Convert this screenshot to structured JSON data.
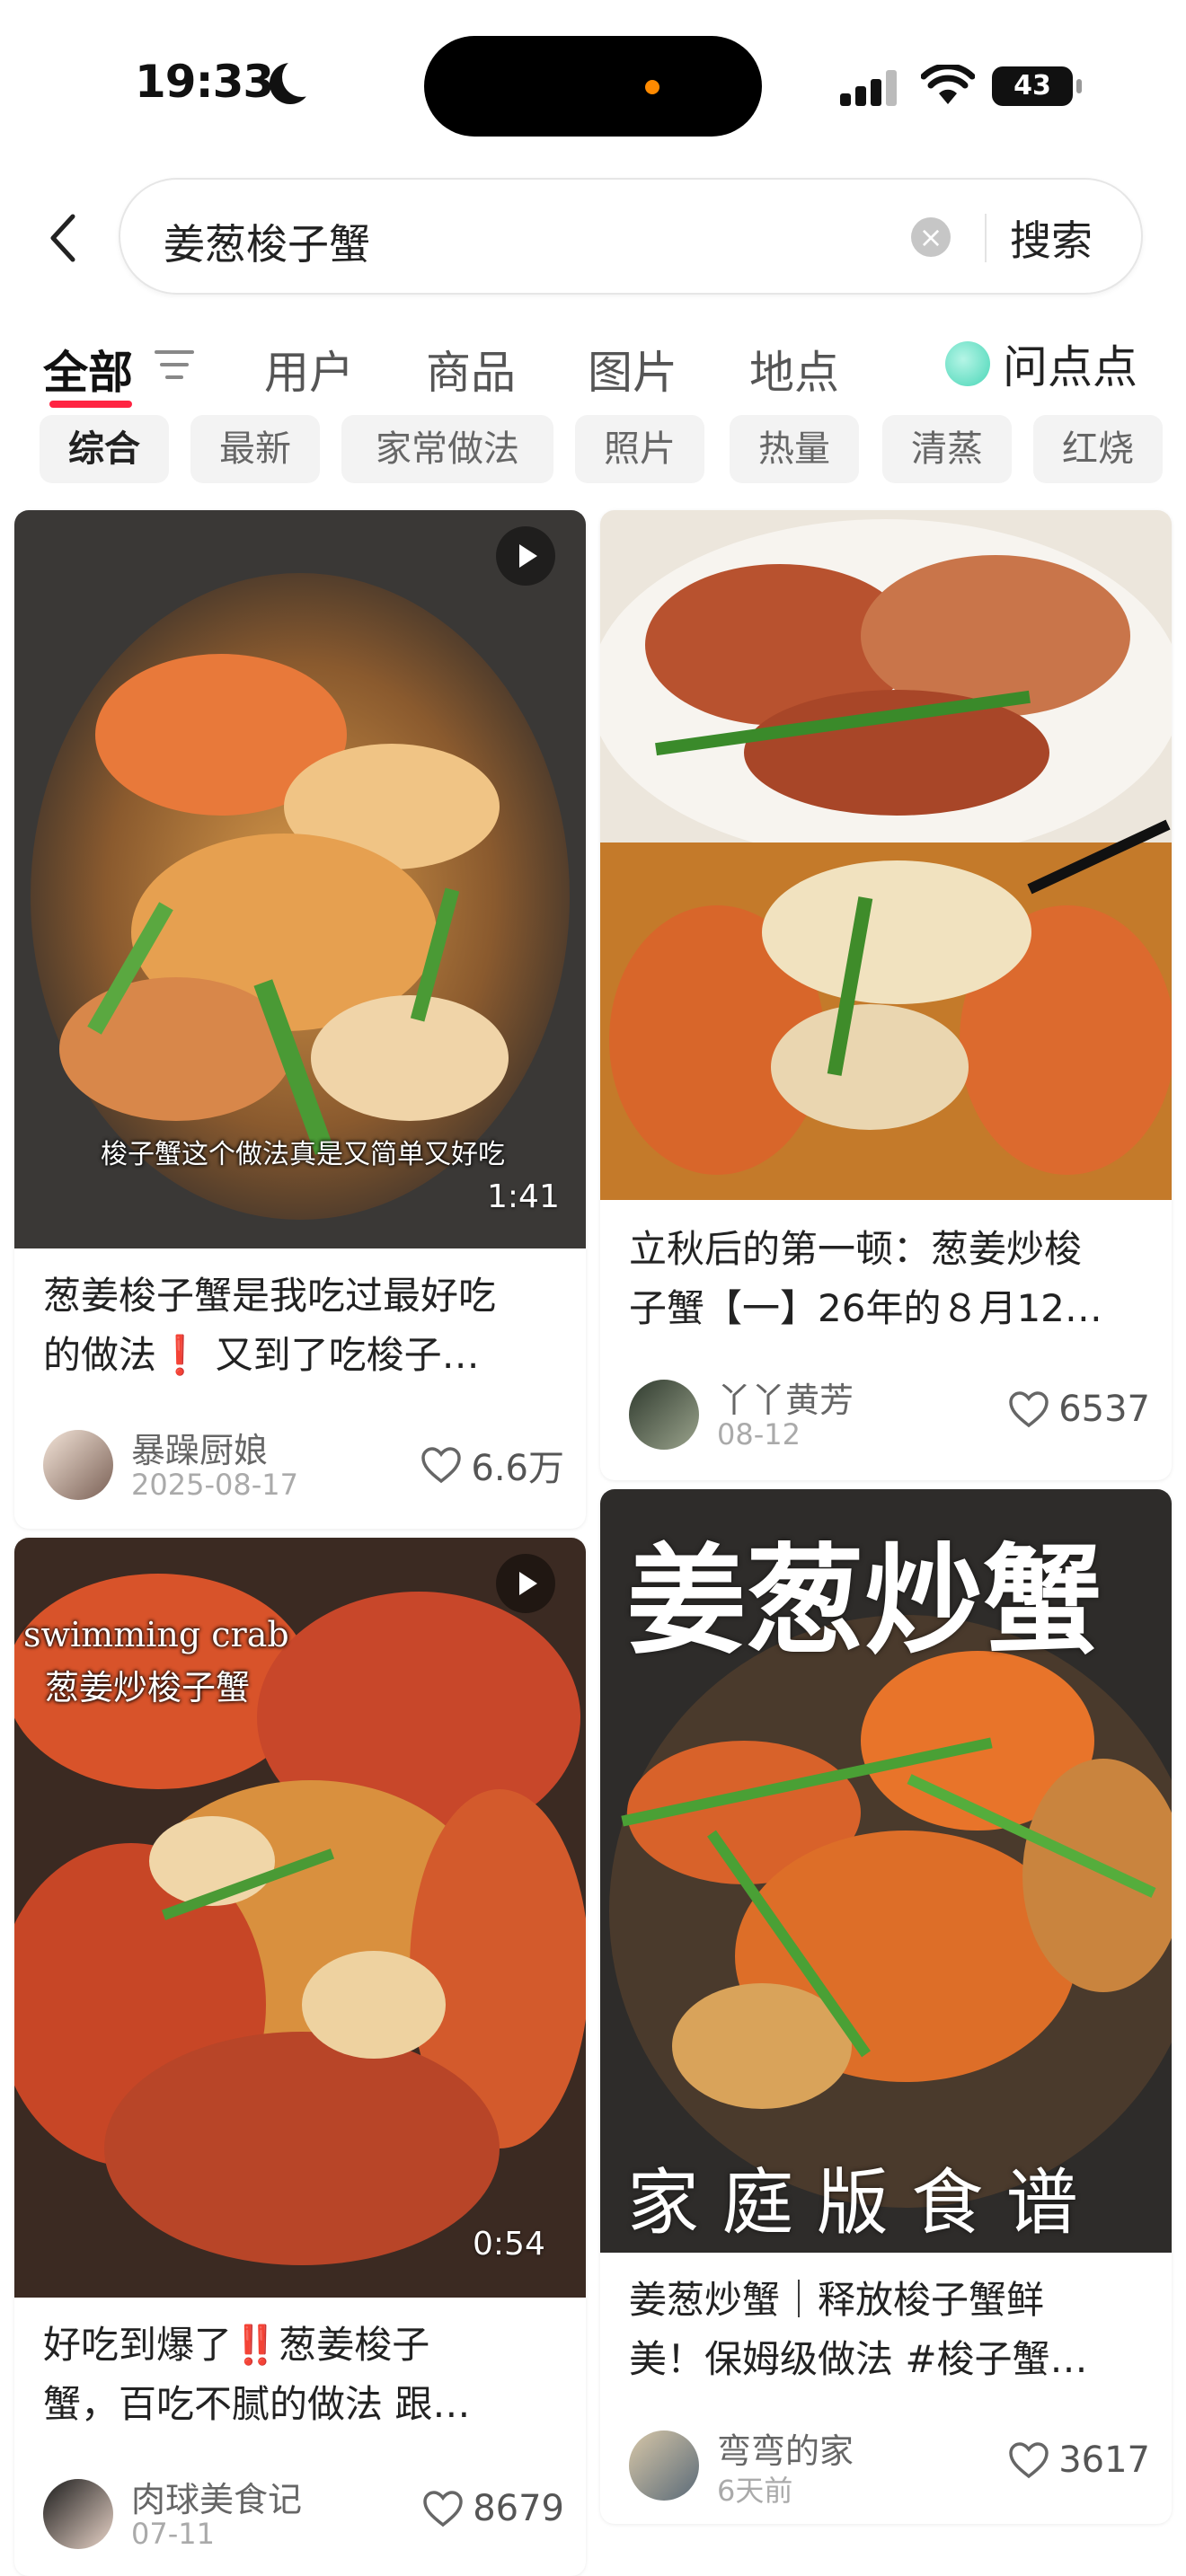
{
  "status": {
    "time": "19:33",
    "battery": "43"
  },
  "search": {
    "query": "姜葱梭子蟹",
    "button": "搜索"
  },
  "tabs": [
    {
      "label": "全部"
    },
    {
      "label": "用户"
    },
    {
      "label": "商品"
    },
    {
      "label": "图片"
    },
    {
      "label": "地点"
    }
  ],
  "ask": {
    "label": "问点点"
  },
  "chips": [
    "综合",
    "最新",
    "家常做法",
    "照片",
    "热量",
    "清蒸",
    "红烧"
  ],
  "cards": [
    {
      "title_l1": "葱姜梭子蟹是我吃过最好吃",
      "title_l2": "的做法❗ 又到了吃梭子…",
      "author": "暴躁厨娘",
      "date": "2025-08-17",
      "likes": "6.6万",
      "duration": "1:41",
      "subtitle": "梭子蟹这个做法真是又简单又好吃"
    },
    {
      "title_l1": "立秋后的第一顿：葱姜炒梭",
      "title_l2": "子蟹【一】26年的８月12…",
      "author": "丫丫黄芳",
      "date": "08-12",
      "likes": "6537"
    },
    {
      "title_l1": "好吃到爆了‼️葱姜梭子",
      "title_l2": "蟹，百吃不腻的做法 跟…",
      "author": "肉球美食记",
      "date": "07-11",
      "likes": "8679",
      "duration": "0:54",
      "overlay_en": "swimming crab",
      "overlay_cn": "葱姜炒梭子蟹"
    },
    {
      "title_l1": "姜葱炒蟹｜释放梭子蟹鲜",
      "title_l2": "美！保姆级做法 #梭子蟹…",
      "author": "弯弯的家",
      "date": "6天前",
      "likes": "3617",
      "overlay_top": "姜葱炒蟹",
      "overlay_bottom": "家 庭 版 食 谱"
    }
  ]
}
